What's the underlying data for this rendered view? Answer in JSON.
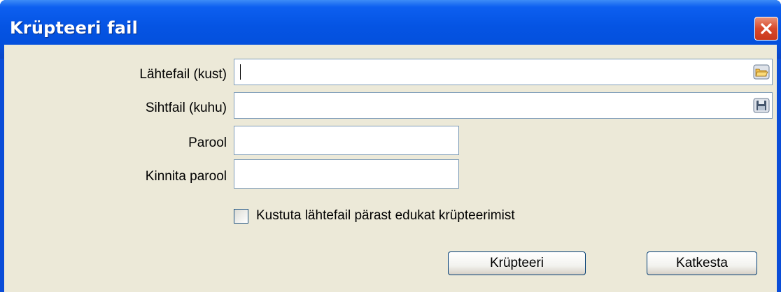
{
  "window": {
    "title": "Krüpteeri fail",
    "close_icon": "close-icon"
  },
  "form": {
    "source_label": "Lähtefail (kust)",
    "source_value": "",
    "target_label": "Sihtfail (kuhu)",
    "target_value": "",
    "password_label": "Parool",
    "password_value": "",
    "confirm_label": "Kinnita parool",
    "confirm_value": "",
    "browse_icon": "folder-open-icon",
    "save_icon": "floppy-disk-icon",
    "delete_checkbox_label": "Kustuta lähtefail pärast edukat krüpteerimist",
    "delete_checkbox_checked": false
  },
  "buttons": {
    "encrypt": "Krüpteeri",
    "cancel": "Katkesta"
  },
  "colors": {
    "titlebar": "#0554e3",
    "client_bg": "#ece9d8",
    "field_border": "#7f9db9",
    "close_button": "#d8482a"
  }
}
